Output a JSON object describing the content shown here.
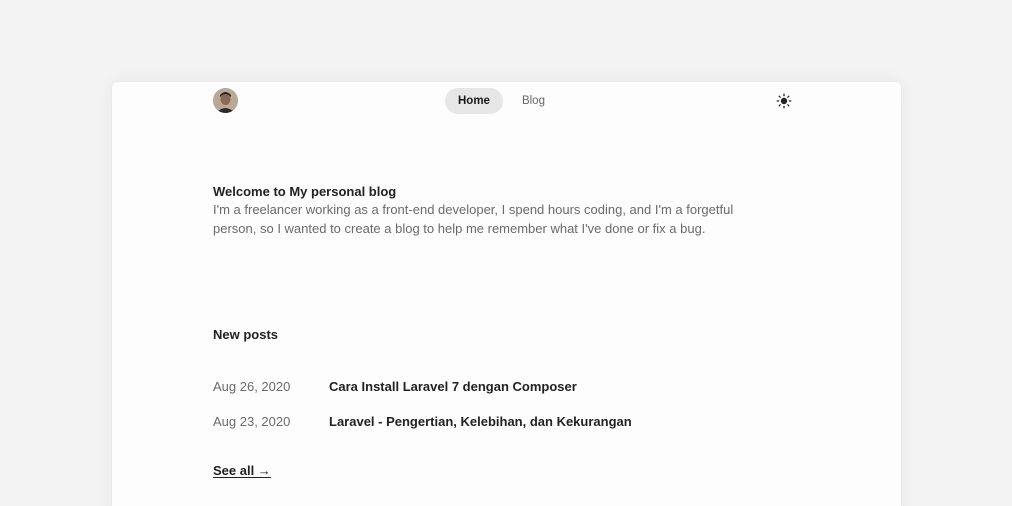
{
  "header": {
    "avatar_icon": "avatar-photo",
    "nav": [
      {
        "label": "Home",
        "active": true
      },
      {
        "label": "Blog",
        "active": false
      }
    ],
    "theme_icon": "sun-icon"
  },
  "intro": {
    "title": "Welcome to My personal blog",
    "text": "I'm a freelancer working as a front-end developer, I spend hours coding, and I'm a forgetful person, so I wanted to create a blog to help me remember what I've done or fix a bug."
  },
  "posts_section": {
    "title": "New posts",
    "items": [
      {
        "date": "Aug 26, 2020",
        "title": "Cara Install Laravel 7 dengan Composer"
      },
      {
        "date": "Aug 23, 2020",
        "title": "Laravel - Pengertian, Kelebihan, dan Kekurangan"
      }
    ],
    "see_all": "See all →"
  },
  "colors": {
    "page_bg": "#f3f3f3",
    "card_bg": "#fdfdfd",
    "active_pill": "#e6e6e6"
  }
}
